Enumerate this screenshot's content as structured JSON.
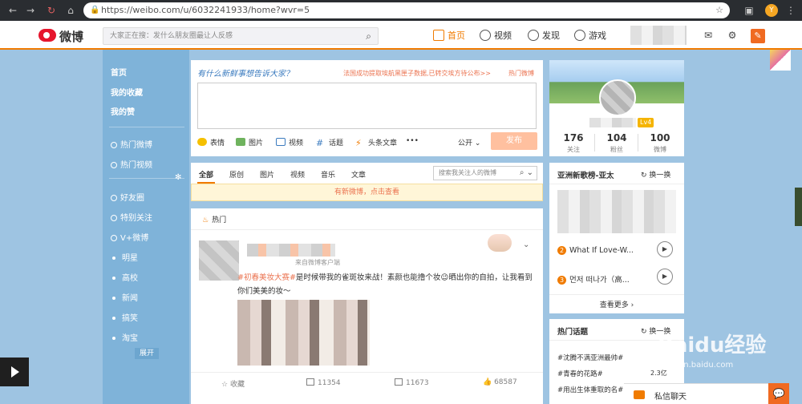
{
  "browser": {
    "url": "https://weibo.com/u/6032241933/home?wvr=5",
    "profile_initial": "Y"
  },
  "header": {
    "logo_text": "微博",
    "search_placeholder": "大家正在搜：发什么朋友圈最让人反感",
    "nav": [
      {
        "label": "首页",
        "icon": "home-icon"
      },
      {
        "label": "视频",
        "icon": "video-icon"
      },
      {
        "label": "发现",
        "icon": "discover-icon"
      },
      {
        "label": "游戏",
        "icon": "game-icon"
      }
    ]
  },
  "sidebar": {
    "top": [
      "首页",
      "我的收藏",
      "我的赞"
    ],
    "hot": [
      "热门微博",
      "热门视频"
    ],
    "groups": [
      "好友圈",
      "特别关注",
      "V+微博"
    ],
    "subs": [
      "明星",
      "高校",
      "新闻",
      "搞笑",
      "淘宝"
    ],
    "expand": "展开"
  },
  "composer": {
    "title": "有什么新鲜事想告诉大家？",
    "trend": "法国成功提取埃航黑匣子数据,已转交埃方待公布>>",
    "hot_link": "热门微博",
    "tools": [
      "表情",
      "图片",
      "视频",
      "话题",
      "头条文章",
      "•••"
    ],
    "visibility": "公开",
    "publish": "发布"
  },
  "feed_tabs": {
    "tabs": [
      "全部",
      "原创",
      "图片",
      "视频",
      "音乐",
      "文章"
    ],
    "search_placeholder": "搜索我关注人的微博",
    "notice": "有新微博，点击查看"
  },
  "post": {
    "section": "热门",
    "from": "来自微博客户端",
    "tag": "#初春美妆大赛#",
    "text": "是时候带我的雀斑妆来战！素颜也能撸个妆😉晒出你的自拍，让我看到你们美美的妆～",
    "actions": [
      {
        "label": "收藏",
        "icon": "star-icon"
      },
      {
        "label": "11354",
        "icon": "share-icon"
      },
      {
        "label": "11673",
        "icon": "comment-icon"
      },
      {
        "label": "68587",
        "icon": "like-icon"
      }
    ]
  },
  "profile": {
    "level": "Lv4",
    "stats": [
      {
        "num": "176",
        "label": "关注"
      },
      {
        "num": "104",
        "label": "粉丝"
      },
      {
        "num": "100",
        "label": "微博"
      }
    ]
  },
  "chart": {
    "title": "亚洲新歌榜-亚太",
    "change": "换一换",
    "songs": [
      {
        "rank": "2",
        "title": "What If Love-W..."
      },
      {
        "rank": "3",
        "title": "먼저 떠나가（高..."
      }
    ],
    "more": "查看更多 ›"
  },
  "topics": {
    "title": "热门话题",
    "change": "换一换",
    "items": [
      {
        "name": "#沈腾不满亚洲最帅#",
        "count": ""
      },
      {
        "name": "#青春的花路#",
        "count": "2.3亿"
      },
      {
        "name": "#用出生体重取的名#",
        "count": ""
      }
    ]
  },
  "messenger": {
    "label": "私信聊天"
  },
  "watermark": {
    "brand": "Baidu经验",
    "sub": "jingyan.baidu.com"
  }
}
